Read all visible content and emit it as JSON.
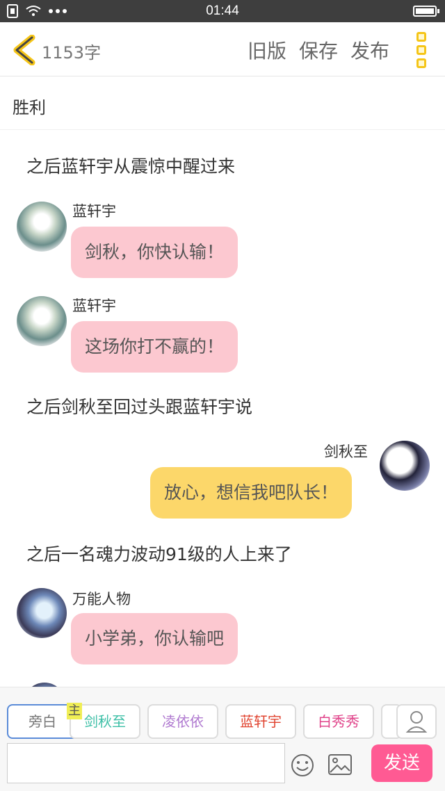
{
  "status_bar": {
    "time": "01:44"
  },
  "topbar": {
    "word_count": "1153字",
    "actions": [
      "旧版",
      "保存",
      "发布"
    ]
  },
  "story_title": "胜利",
  "messages": [
    {
      "type": "narration",
      "text": "之后蓝轩宇从震惊中醒过来"
    },
    {
      "type": "left",
      "name": "蓝轩宇",
      "text": "剑秋，你快认输！"
    },
    {
      "type": "left",
      "name": "蓝轩宇",
      "text": "这场你打不赢的！"
    },
    {
      "type": "narration",
      "text": "之后剑秋至回过头跟蓝轩宇说"
    },
    {
      "type": "right",
      "name": "剑秋至",
      "text": "放心，想信我吧队长！"
    },
    {
      "type": "narration",
      "text": "之后一名魂力波动91级的人上来了"
    },
    {
      "type": "left",
      "name": "万能人物",
      "text": "小学弟，你认输吧"
    }
  ],
  "roles": [
    {
      "label": "旁白",
      "color": "#777777"
    },
    {
      "label": "剑秋至",
      "color": "#3cbfa6",
      "badge": "主"
    },
    {
      "label": "凌依依",
      "color": "#b07ad0"
    },
    {
      "label": "蓝轩宇",
      "color": "#e0432f"
    },
    {
      "label": "白秀秀",
      "color": "#e0438a"
    }
  ],
  "composer": {
    "send_label": "发送",
    "placeholder": ""
  }
}
